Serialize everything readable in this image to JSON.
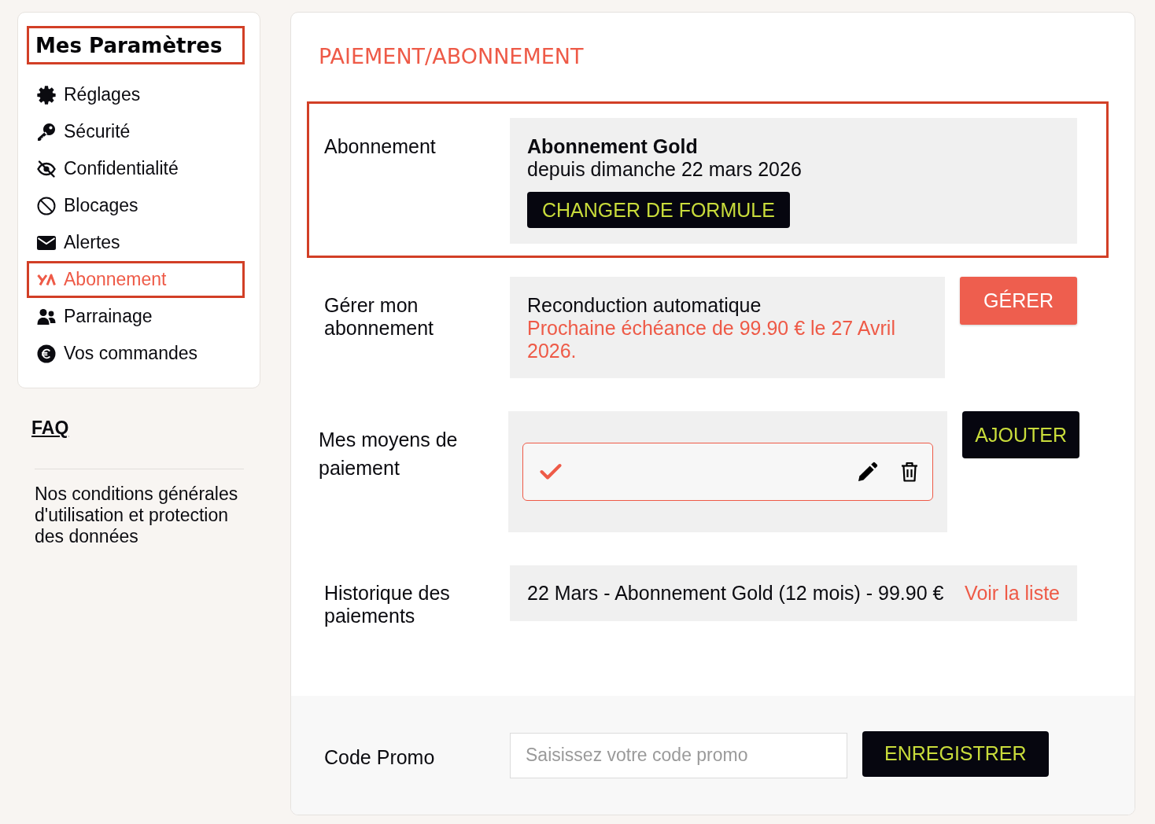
{
  "sidebar": {
    "title": {
      "text": "Mes Paramètres",
      "highlighted": true
    },
    "items": [
      {
        "label": "Réglages",
        "selected": false
      },
      {
        "label": "Sécurité",
        "selected": false
      },
      {
        "label": "Confidentialité",
        "selected": false
      },
      {
        "label": "Blocages",
        "selected": false
      },
      {
        "label": "Alertes",
        "selected": false
      },
      {
        "label": "Abonnement",
        "selected": true
      },
      {
        "label": "Parrainage",
        "selected": false
      },
      {
        "label": "Vos commandes",
        "selected": false
      }
    ],
    "faq": "FAQ",
    "terms": "Nos conditions générales d'utilisation et protection des données"
  },
  "main": {
    "title": "PAIEMENT/ABONNEMENT",
    "subscription": {
      "label": "Abonnement",
      "highlighted": true,
      "plan": "Abonnement Gold",
      "since": "depuis dimanche 22 mars 2026",
      "button": "CHANGER DE FORMULE"
    },
    "manage": {
      "label": "Gérer mon abonnement",
      "renewal": "Reconduction automatique",
      "next_due": "Prochaine échéance de 99.90 € le 27 Avril 2026.",
      "button": "GÉRER"
    },
    "payment_methods": {
      "label": "Mes moyens de paiement",
      "methods": [
        {
          "selected": true
        }
      ],
      "button": "AJOUTER"
    },
    "history": {
      "label": "Historique des paiements",
      "entry": "22 Mars - Abonnement Gold (12 mois) - 99.90 €",
      "link": "Voir la liste"
    },
    "promo": {
      "label": "Code Promo",
      "placeholder": "Saisissez votre code promo",
      "button": "ENREGISTRER"
    }
  }
}
